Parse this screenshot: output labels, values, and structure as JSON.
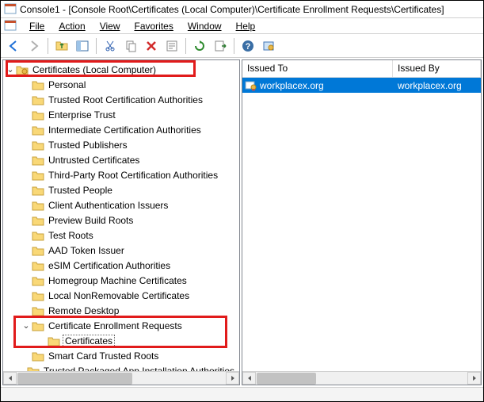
{
  "titlebar": {
    "text": "Console1 - [Console Root\\Certificates (Local Computer)\\Certificate Enrollment Requests\\Certificates]"
  },
  "menu": {
    "file": "File",
    "action": "Action",
    "view": "View",
    "favorites": "Favorites",
    "window": "Window",
    "help": "Help"
  },
  "toolbar_icons": {
    "back": "back-arrow-icon",
    "forward": "forward-arrow-icon",
    "up": "up-folder-icon",
    "show_tree": "show-tree-icon",
    "cut": "cut-icon",
    "copy": "copy-icon",
    "delete": "delete-icon",
    "properties": "properties-icon",
    "refresh": "refresh-icon",
    "export": "export-list-icon",
    "help": "help-icon",
    "cert_button": "certificate-bar-icon"
  },
  "tree": {
    "root": "Certificates (Local Computer)",
    "items": [
      "Personal",
      "Trusted Root Certification Authorities",
      "Enterprise Trust",
      "Intermediate Certification Authorities",
      "Trusted Publishers",
      "Untrusted Certificates",
      "Third-Party Root Certification Authorities",
      "Trusted People",
      "Client Authentication Issuers",
      "Preview Build Roots",
      "Test Roots",
      "AAD Token Issuer",
      "eSIM Certification Authorities",
      "Homegroup Machine Certificates",
      "Local NonRemovable Certificates",
      "Remote Desktop",
      "Certificate Enrollment Requests"
    ],
    "cert_child": "Certificates",
    "after": [
      "Smart Card Trusted Roots",
      "Trusted Packaged App Installation Authorities"
    ]
  },
  "list": {
    "col_a": "Issued To",
    "col_b": "Issued By",
    "rows": [
      {
        "issued_to": "workplacex.org",
        "issued_by": "workplacex.org"
      }
    ]
  }
}
